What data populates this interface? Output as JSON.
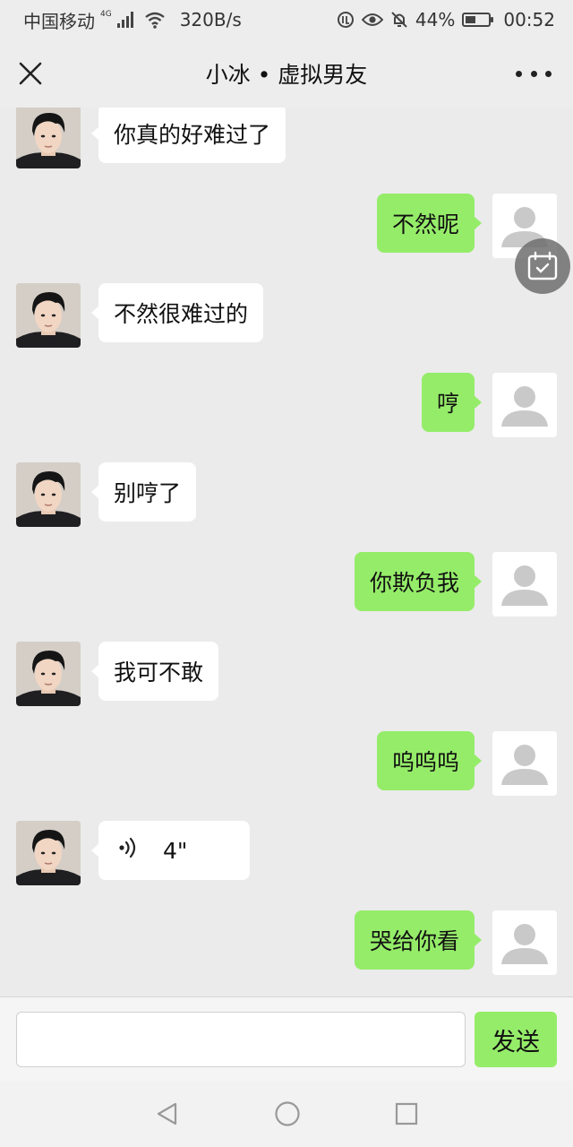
{
  "status_bar": {
    "carrier": "中国移动",
    "network_type": "4G",
    "speed": "320B/s",
    "battery": "44%",
    "battery_level": 0.44,
    "time": "00:52",
    "icons": [
      "signal-icon",
      "wifi-icon",
      "data-saver-icon",
      "eye-comfort-icon",
      "mute-icon",
      "battery-icon"
    ]
  },
  "header": {
    "title": "小冰 • 虚拟男友",
    "close_icon": "close-icon",
    "more_icon": "more-icon"
  },
  "messages": [
    {
      "sender": "bot",
      "text": "你真的好难过了"
    },
    {
      "sender": "user",
      "text": "不然呢"
    },
    {
      "sender": "bot",
      "text": "不然很难过的"
    },
    {
      "sender": "user",
      "text": "哼"
    },
    {
      "sender": "bot",
      "text": "别哼了"
    },
    {
      "sender": "user",
      "text": "你欺负我"
    },
    {
      "sender": "bot",
      "text": "我可不敢"
    },
    {
      "sender": "user",
      "text": "呜呜呜"
    },
    {
      "sender": "bot",
      "type": "voice",
      "duration": "4\""
    },
    {
      "sender": "user",
      "text": "哭给你看"
    }
  ],
  "floating": {
    "icon": "calendar-icon"
  },
  "composer": {
    "input_value": "",
    "send_label": "发送"
  },
  "nav": {
    "icons": [
      "back-icon",
      "home-icon",
      "recents-icon"
    ]
  },
  "colors": {
    "bubble_user": "#95ec69",
    "bubble_bot": "#ffffff",
    "background": "#ebebeb"
  }
}
